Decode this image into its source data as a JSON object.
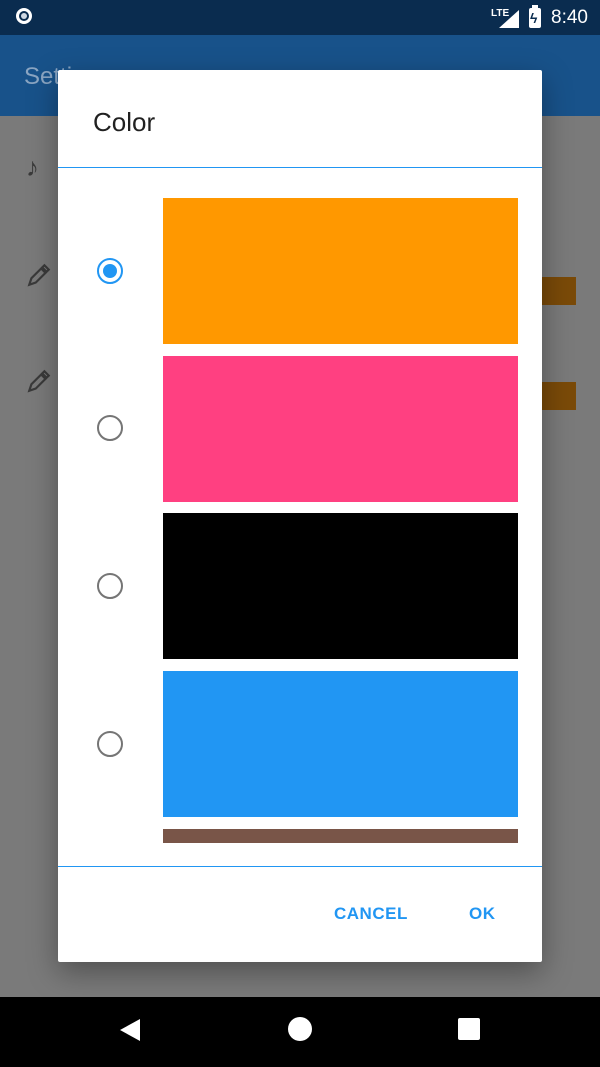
{
  "status_bar": {
    "time": "8:40",
    "network_label": "LTE",
    "icons": [
      "notification-icon",
      "lte-signal-icon",
      "battery-charging-icon"
    ]
  },
  "app_bar": {
    "title": "Setti"
  },
  "background_icons": [
    "music-note-icon",
    "eyedropper-icon",
    "eyedropper-icon"
  ],
  "dialog": {
    "title": "Color",
    "options": [
      {
        "name": "orange",
        "color": "#ff9800",
        "selected": true
      },
      {
        "name": "pink",
        "color": "#ff4081",
        "selected": false
      },
      {
        "name": "black",
        "color": "#000000",
        "selected": false
      },
      {
        "name": "blue",
        "color": "#2196f3",
        "selected": false
      },
      {
        "name": "brown",
        "color": "#795548",
        "selected": false
      }
    ],
    "buttons": {
      "cancel": "CANCEL",
      "ok": "OK"
    }
  },
  "colors": {
    "accent": "#2196f3",
    "status_bar": "#0a2c4f",
    "app_bar": "#18528a"
  },
  "nav_bar": {
    "icons": [
      "back-icon",
      "home-icon",
      "recents-icon"
    ]
  }
}
